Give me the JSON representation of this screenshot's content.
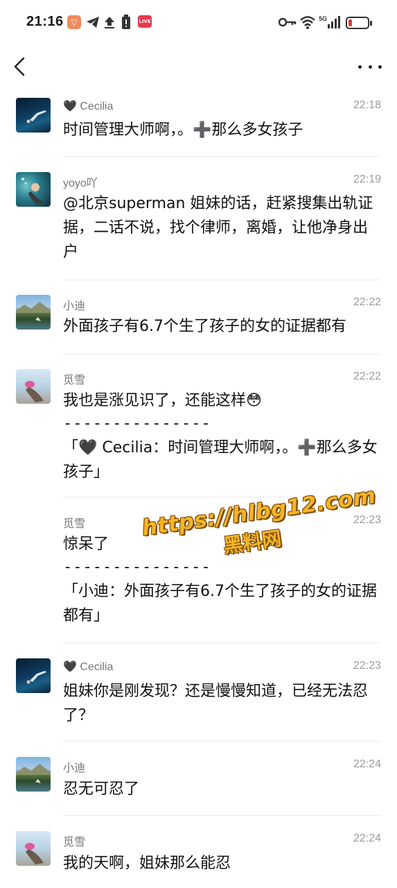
{
  "status_bar": {
    "time": "21:16",
    "network": "5G",
    "colors": {
      "battery_low": "#e53935"
    }
  },
  "nav": {
    "back_icon": "chevron-left-icon",
    "more_icon": "more-horizontal-icon"
  },
  "comments": [
    {
      "user": "🖤 Cecilia",
      "time": "22:18",
      "text": "时间管理大师啊，。➕那么多女孩子",
      "avatar": "deep-sea-diver"
    },
    {
      "user": "yoyo吖",
      "time": "22:19",
      "text": "@北京superman 姐妹的话，赶紧搜集出轨证据，二话不说，找个律师，离婚，让他净身出户",
      "avatar": "underwater-swimmer"
    },
    {
      "user": "小迪",
      "time": "22:22",
      "text": "外面孩子有6.7个生了孩子的女的证据都有",
      "avatar": "mountain-lake"
    },
    {
      "user": "觅雪",
      "time": "22:22",
      "text": "我也是涨见识了，还能这样😳",
      "dashes": "---------------",
      "quote": "「🖤 Cecilia：时间管理大师啊，。➕那么多女孩子」",
      "avatar": "beach-girl"
    },
    {
      "user": "觅雪",
      "time": "22:23",
      "text": "惊呆了",
      "dashes": "---------------",
      "quote": "「小迪：外面孩子有6.7个生了孩子的女的证据都有」"
    },
    {
      "user": "🖤 Cecilia",
      "time": "22:23",
      "text": "姐妹你是刚发现？还是慢慢知道，已经无法忍了？",
      "avatar": "deep-sea-diver"
    },
    {
      "user": "小迪",
      "time": "22:24",
      "text": "忍无可忍了",
      "avatar": "mountain-lake"
    },
    {
      "user": "觅雪",
      "time": "22:24",
      "text": "我的天啊，姐妹那么能忍",
      "avatar": "beach-girl"
    }
  ],
  "watermark": {
    "url": "https://hlbg12.com",
    "site": "黑料网",
    "color": "#f5b428"
  }
}
